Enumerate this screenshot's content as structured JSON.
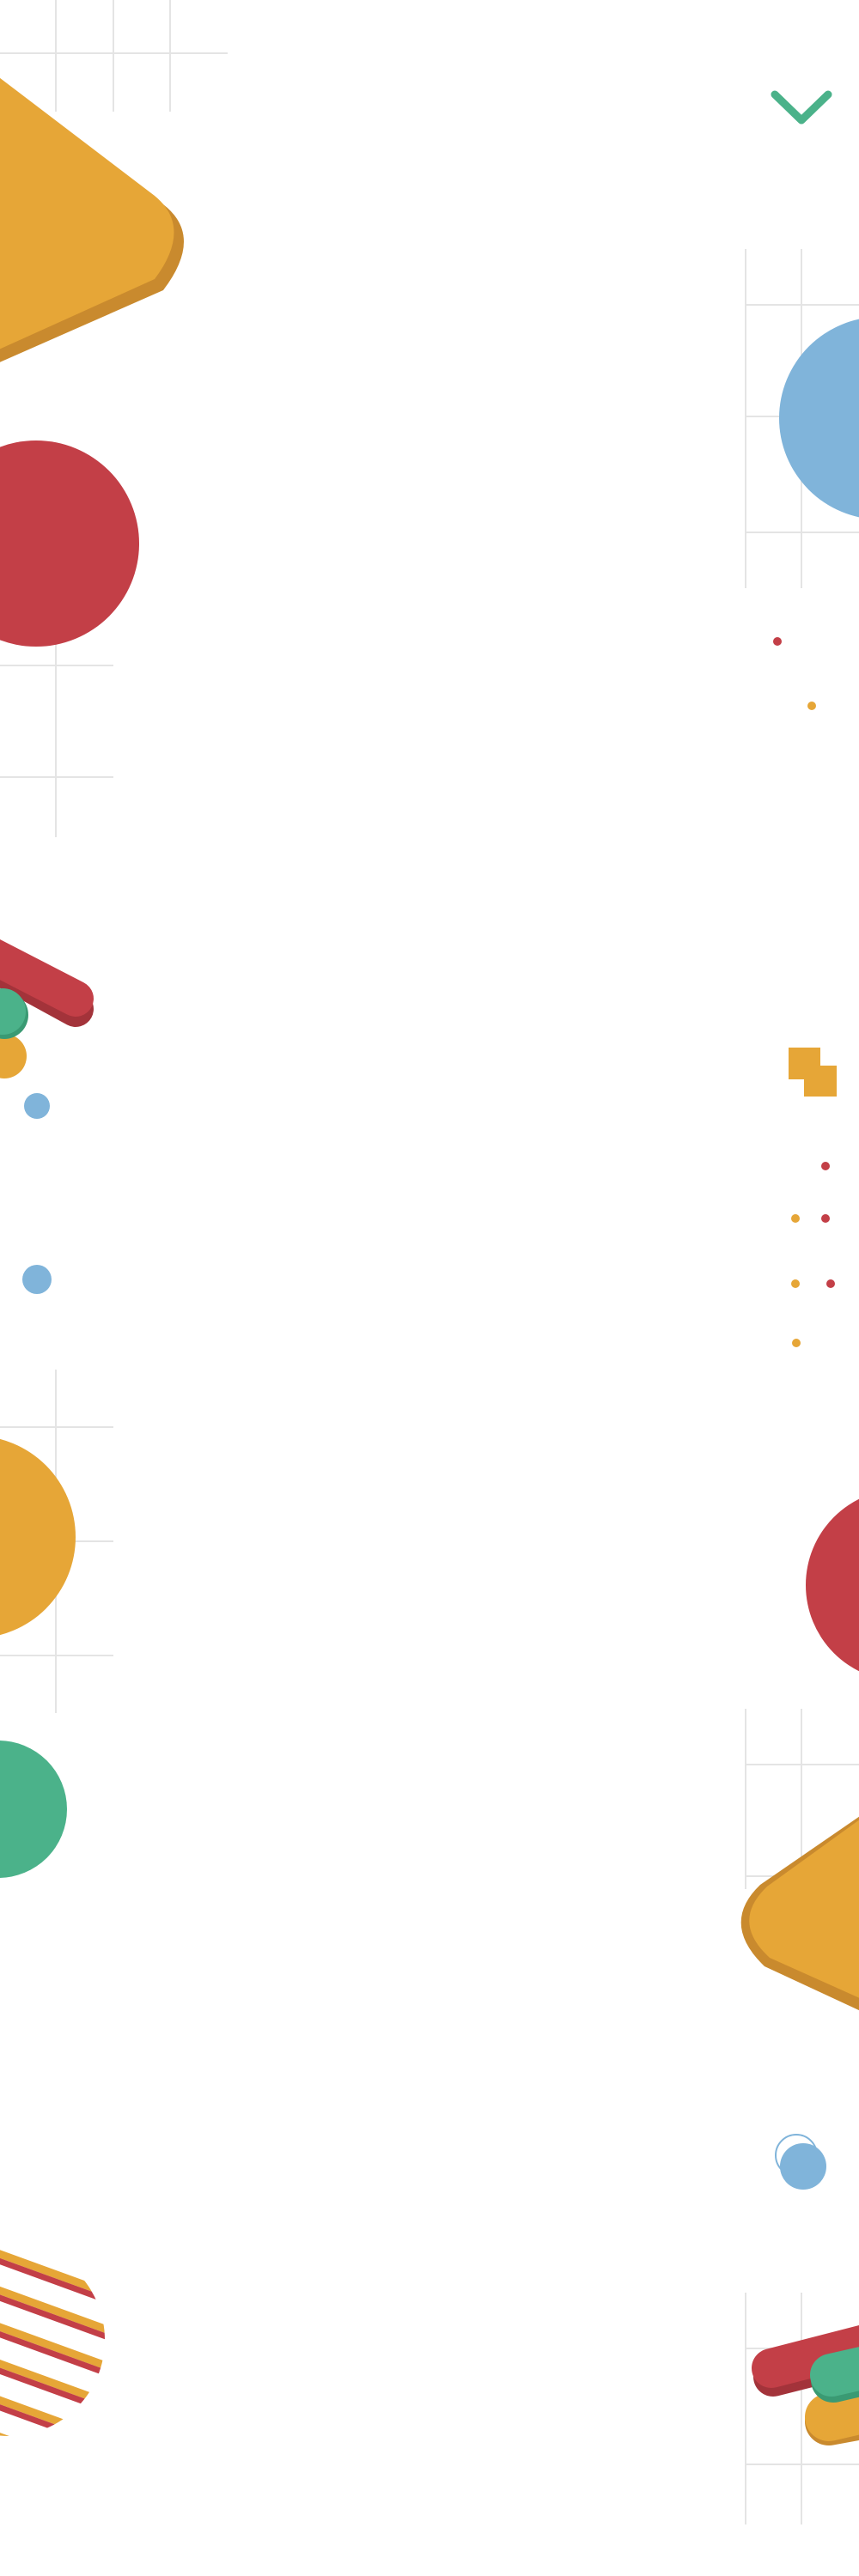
{
  "colors": {
    "yellow": "#e6a637",
    "yellow_shade": "#c98a2e",
    "red": "#c33f47",
    "red_shade": "#a3333a",
    "green": "#4bb28a",
    "green_shade": "#3a9a73",
    "blue": "#80b4da",
    "grid": "#e4e4e4",
    "background": "#ffffff"
  },
  "icons": {
    "scroll_down": "chevron-down-icon"
  }
}
